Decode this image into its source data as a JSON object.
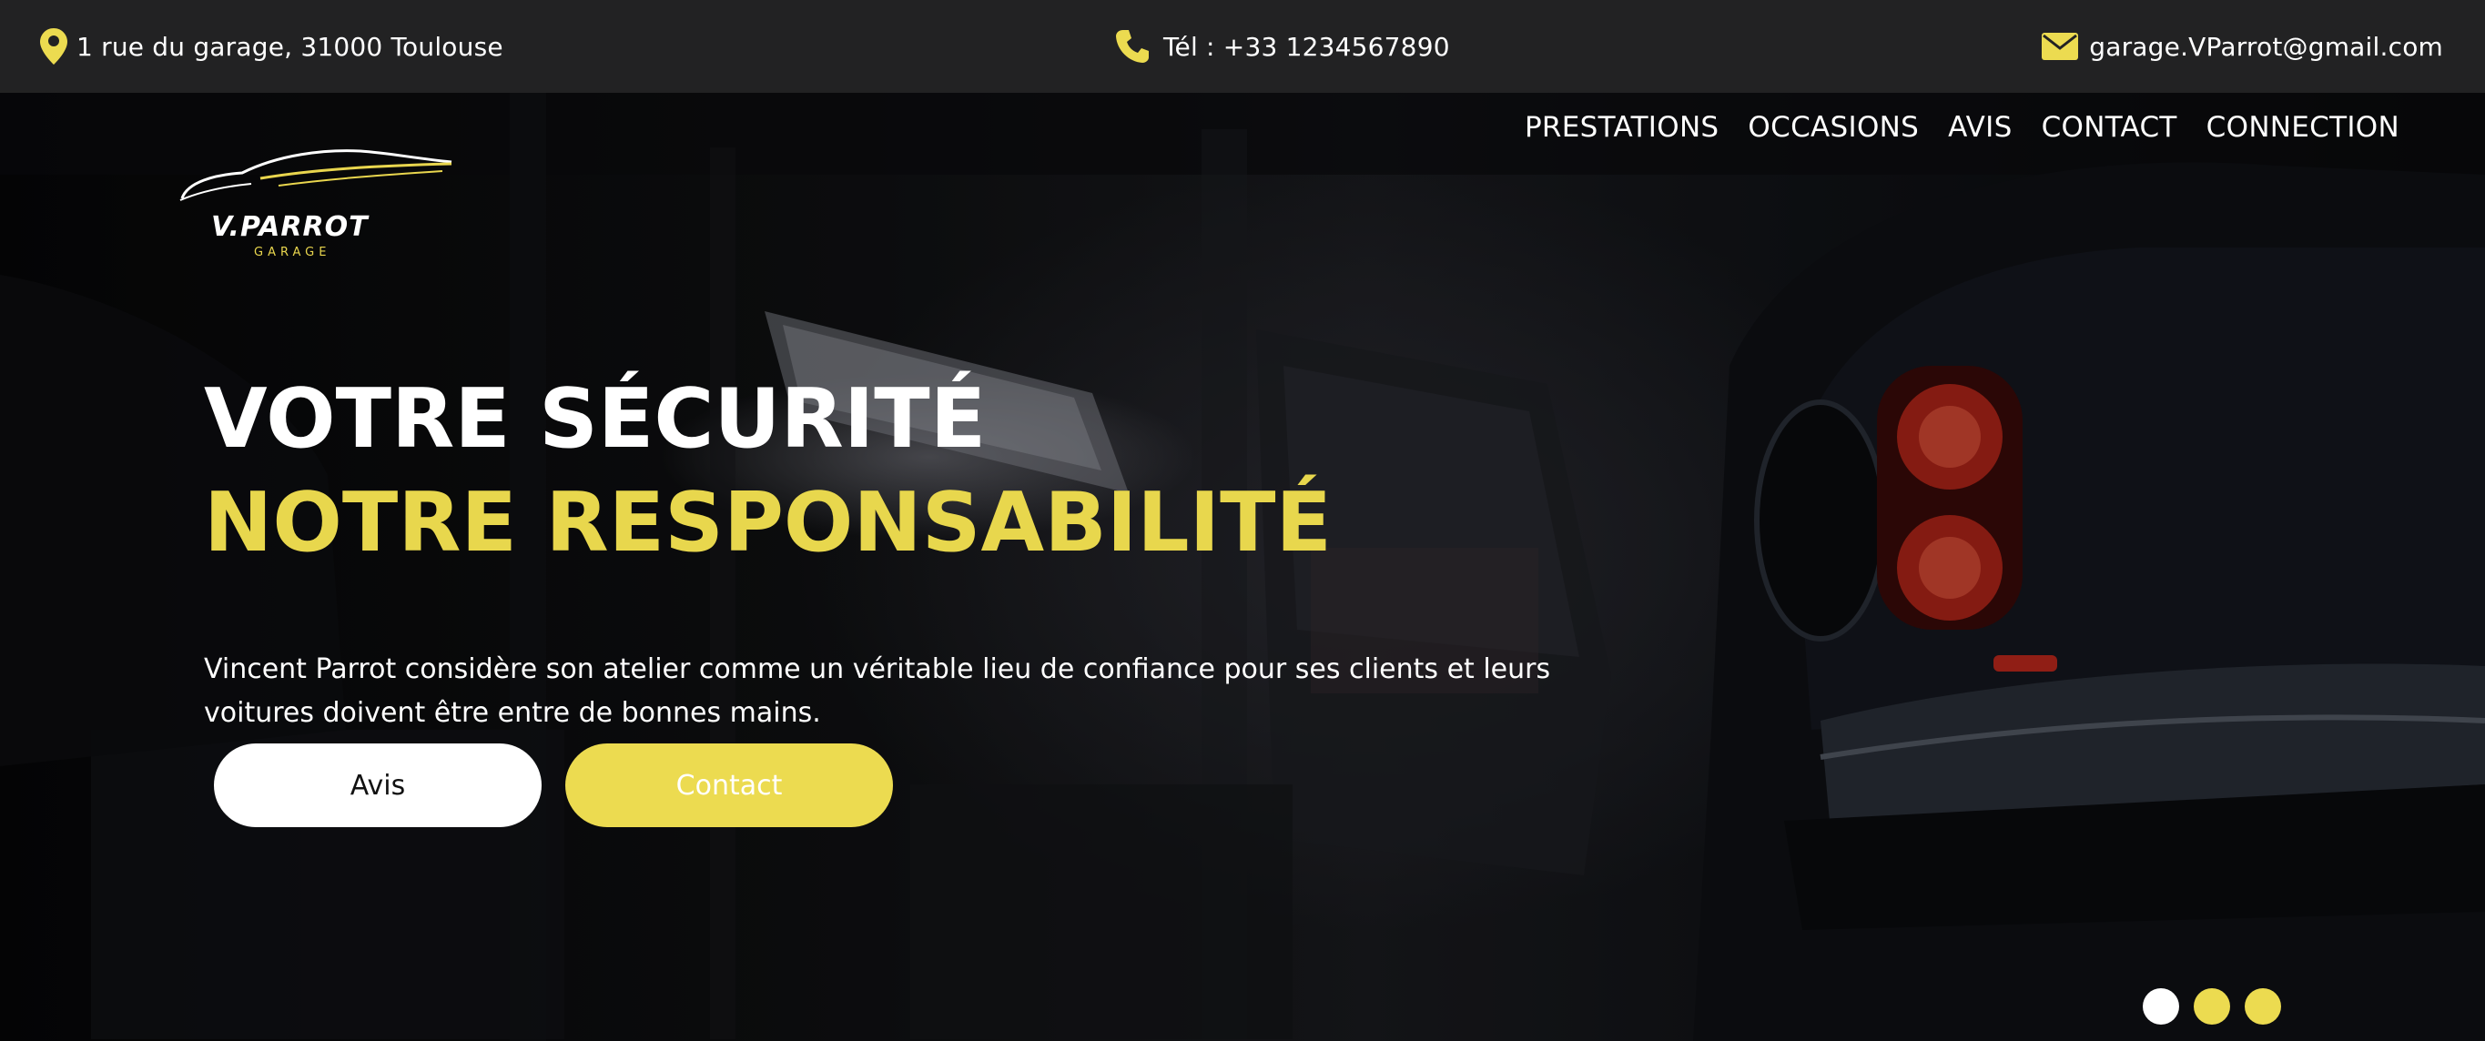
{
  "topbar": {
    "address": "1 rue du garage, 31000 Toulouse",
    "address_icon": "map-pin-icon",
    "phone": "Tél : +33 1234567890",
    "phone_icon": "phone-icon",
    "email": "garage.VParrot@gmail.com",
    "email_icon": "envelope-icon"
  },
  "nav": {
    "items": [
      {
        "label": "PRESTATIONS"
      },
      {
        "label": "OCCASIONS"
      },
      {
        "label": "AVIS"
      },
      {
        "label": "CONTACT"
      },
      {
        "label": "CONNECTION"
      }
    ]
  },
  "logo": {
    "name": "V.PARROT",
    "subtitle": "GARAGE"
  },
  "hero": {
    "title_line1": "VOTRE SÉCURITÉ",
    "title_line2": "NOTRE RESPONSABILITÉ",
    "text": "Vincent Parrot considère son atelier comme un véritable lieu de confiance pour ses clients et leurs voitures doivent être entre de bonnes mains.",
    "buttons": {
      "avis": "Avis",
      "contact": "Contact"
    }
  },
  "slider": {
    "dots": 3,
    "active_index": 0
  },
  "colors": {
    "accent": "#ecdb50",
    "topbar_bg": "#222223",
    "text": "#ffffff"
  }
}
